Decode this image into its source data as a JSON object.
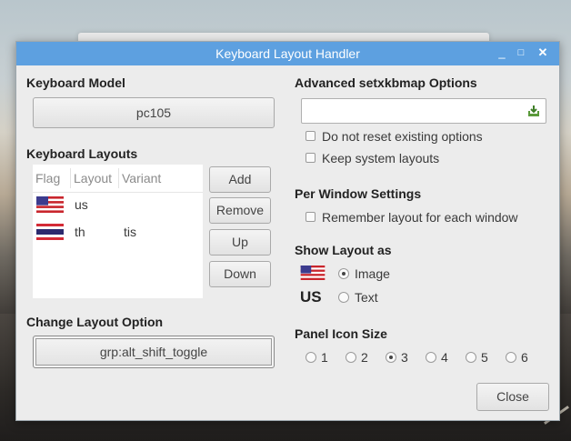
{
  "window": {
    "title": "Keyboard Layout Handler"
  },
  "keyboard_model": {
    "heading": "Keyboard Model",
    "value": "pc105"
  },
  "keyboard_layouts": {
    "heading": "Keyboard Layouts",
    "columns": [
      "Flag",
      "Layout",
      "Variant"
    ],
    "rows": [
      {
        "flag": "us-flag-icon",
        "layout": "us",
        "variant": ""
      },
      {
        "flag": "th-flag-icon",
        "layout": "th",
        "variant": "tis"
      }
    ],
    "buttons": {
      "add": "Add",
      "remove": "Remove",
      "up": "Up",
      "down": "Down"
    }
  },
  "change_layout_option": {
    "heading": "Change Layout Option",
    "value": "grp:alt_shift_toggle"
  },
  "advanced": {
    "heading": "Advanced setxkbmap Options",
    "input_value": "",
    "apply_icon": "apply-icon",
    "options": [
      "Do not reset existing options",
      "Keep system layouts"
    ]
  },
  "per_window": {
    "heading": "Per Window Settings",
    "option": "Remember layout for each window"
  },
  "show_layout": {
    "heading": "Show Layout as",
    "text_preview": "US",
    "image_label": "Image",
    "text_label": "Text",
    "selected": "Image"
  },
  "panel_icon_size": {
    "heading": "Panel Icon Size",
    "options": [
      "1",
      "2",
      "3",
      "4",
      "5",
      "6"
    ],
    "selected": "3"
  },
  "close_button": "Close",
  "colors": {
    "titlebar": "#5da0e0",
    "window_bg": "#ececec"
  }
}
